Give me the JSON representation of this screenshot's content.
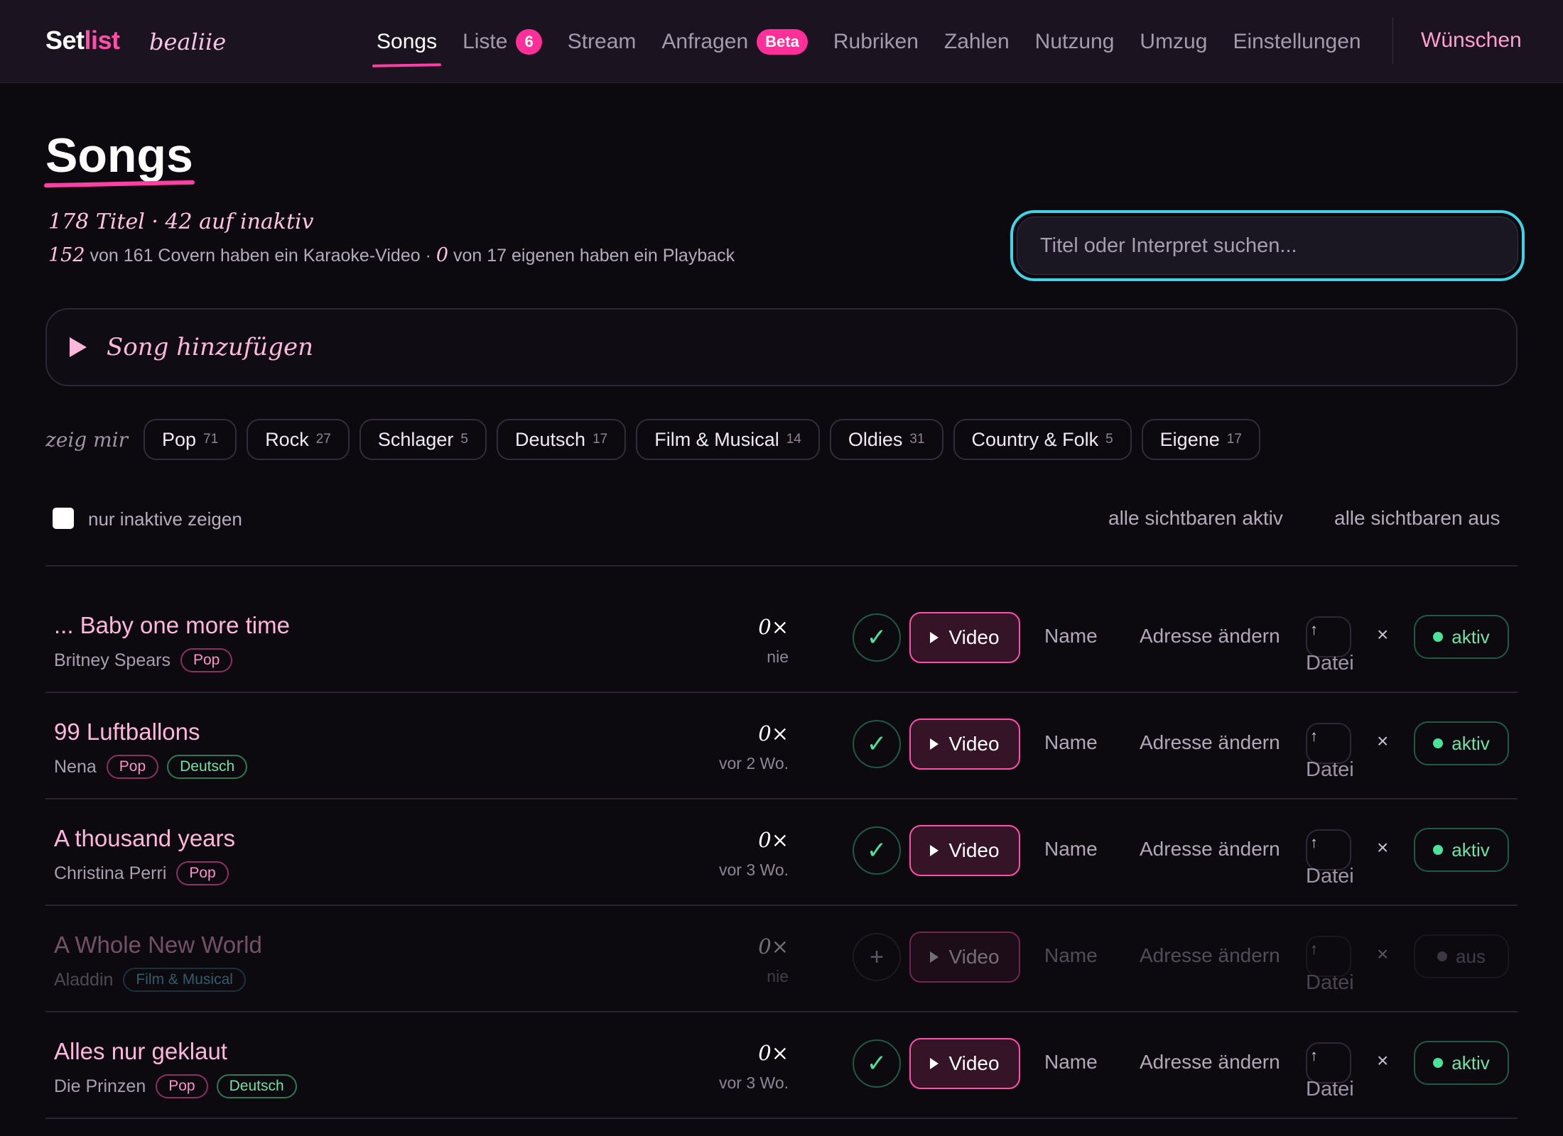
{
  "nav": {
    "brand_a": "Set",
    "brand_b": "list",
    "user": "bealiie",
    "links": [
      {
        "label": "Songs",
        "active": true,
        "badge": ""
      },
      {
        "label": "Liste",
        "active": false,
        "badge": "6"
      },
      {
        "label": "Stream",
        "active": false,
        "badge": ""
      },
      {
        "label": "Anfragen",
        "active": false,
        "badge": "Beta"
      },
      {
        "label": "Rubriken",
        "active": false,
        "badge": ""
      },
      {
        "label": "Zahlen",
        "active": false,
        "badge": ""
      },
      {
        "label": "Nutzung",
        "active": false,
        "badge": ""
      },
      {
        "label": "Umzug",
        "active": false,
        "badge": ""
      },
      {
        "label": "Einstellungen",
        "active": false,
        "badge": ""
      }
    ],
    "wish": "Wünschen"
  },
  "header": {
    "title": "Songs",
    "stats_line": "178 Titel · 42 auf inaktiv",
    "karaoke_num": "152",
    "karaoke_text": " von 161 Covern haben ein Karaoke-Video · ",
    "playback_num": "0",
    "playback_text": " von 17 eigenen haben ein Playback"
  },
  "search": {
    "placeholder": "Titel oder Interpret suchen..."
  },
  "add_song": {
    "label": "Song hinzufügen"
  },
  "filters": {
    "label": "zeig mir",
    "chips": [
      {
        "name": "Pop",
        "count": "71"
      },
      {
        "name": "Rock",
        "count": "27"
      },
      {
        "name": "Schlager",
        "count": "5"
      },
      {
        "name": "Deutsch",
        "count": "17"
      },
      {
        "name": "Film & Musical",
        "count": "14"
      },
      {
        "name": "Oldies",
        "count": "31"
      },
      {
        "name": "Country & Folk",
        "count": "5"
      },
      {
        "name": "Eigene",
        "count": "17"
      }
    ]
  },
  "controls": {
    "only_inactive": "nur inaktive zeigen",
    "all_on": "alle sichtbaren aktiv",
    "all_off": "alle sichtbaren aus"
  },
  "row_labels": {
    "video": "Video",
    "name": "Name",
    "address": "Adresse ändern",
    "file": "Datei",
    "file_icon": "↑",
    "remove": "×",
    "check": "✓",
    "plus": "+"
  },
  "songs": [
    {
      "title": "... Baby one more time",
      "artist": "Britney Spears",
      "tags": [
        {
          "label": "Pop",
          "kind": "pop"
        }
      ],
      "count": "0×",
      "when": "nie",
      "active": true,
      "status": "aktiv"
    },
    {
      "title": "99 Luftballons",
      "artist": "Nena",
      "tags": [
        {
          "label": "Pop",
          "kind": "pop"
        },
        {
          "label": "Deutsch",
          "kind": "deutsch"
        }
      ],
      "count": "0×",
      "when": "vor 2 Wo.",
      "active": true,
      "status": "aktiv"
    },
    {
      "title": "A thousand years",
      "artist": "Christina Perri",
      "tags": [
        {
          "label": "Pop",
          "kind": "pop"
        }
      ],
      "count": "0×",
      "when": "vor 3 Wo.",
      "active": true,
      "status": "aktiv"
    },
    {
      "title": "A Whole New World",
      "artist": "Aladdin",
      "tags": [
        {
          "label": "Film & Musical",
          "kind": "film"
        }
      ],
      "count": "0×",
      "when": "nie",
      "active": false,
      "status": "aus"
    },
    {
      "title": "Alles nur geklaut",
      "artist": "Die Prinzen",
      "tags": [
        {
          "label": "Pop",
          "kind": "pop"
        },
        {
          "label": "Deutsch",
          "kind": "deutsch"
        }
      ],
      "count": "0×",
      "when": "vor 3 Wo.",
      "active": true,
      "status": "aktiv"
    }
  ]
}
